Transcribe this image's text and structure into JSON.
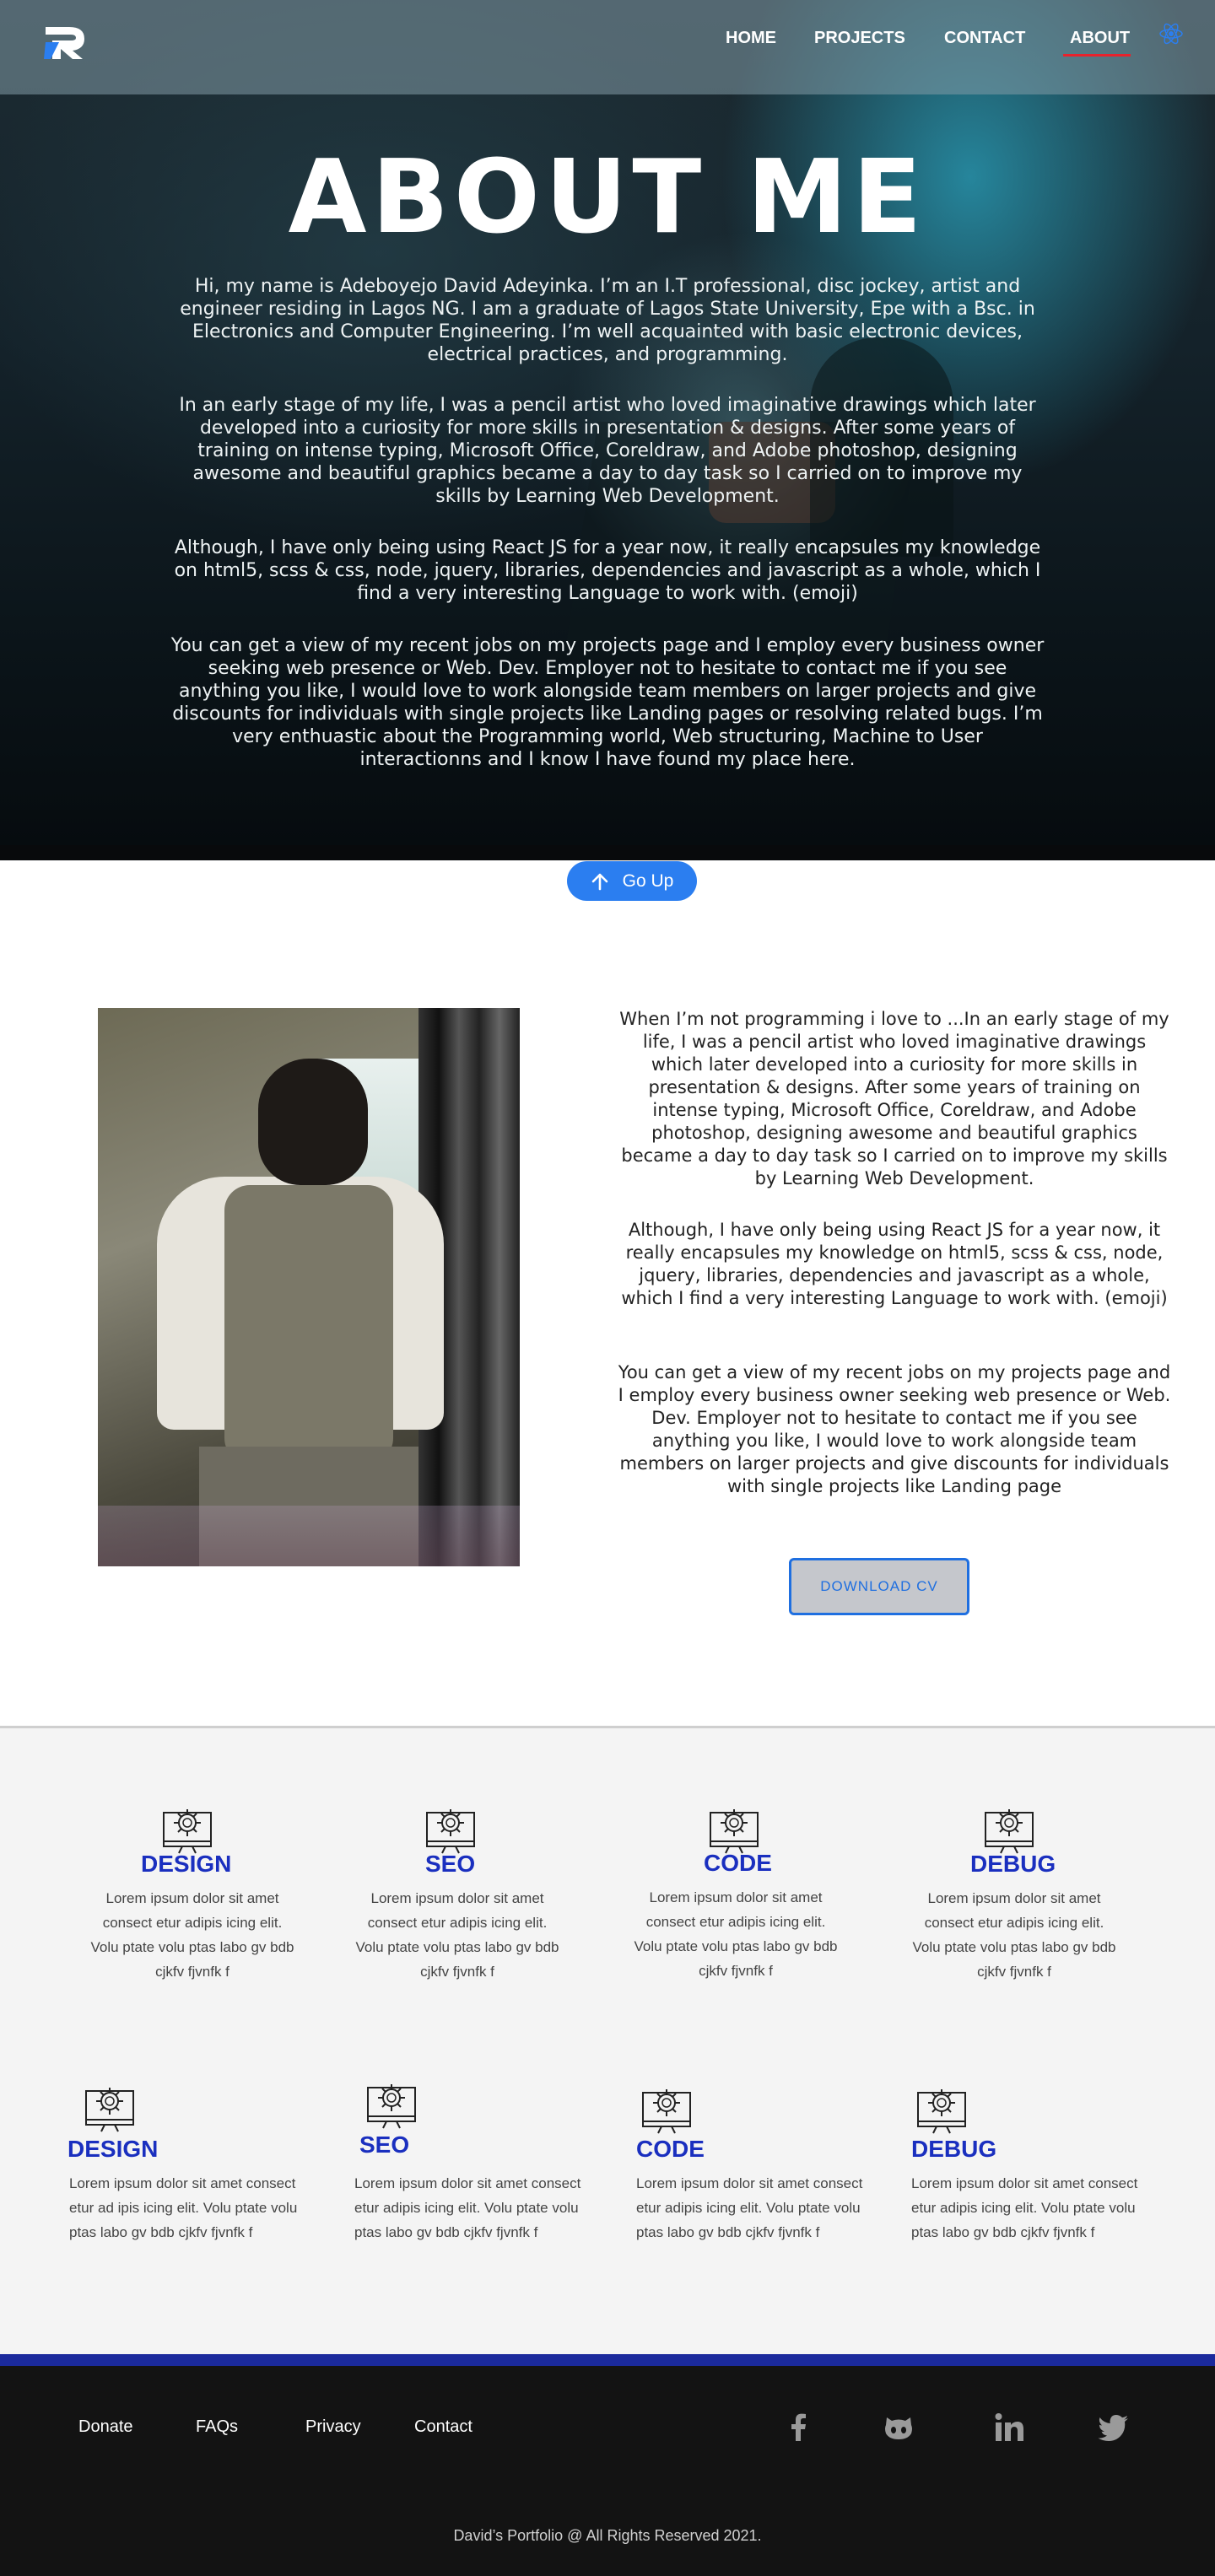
{
  "nav": {
    "items": [
      {
        "label": "HOME"
      },
      {
        "label": "PROJECTS"
      },
      {
        "label": "CONTACT"
      },
      {
        "label": "ABOUT"
      }
    ],
    "active": "ABOUT",
    "accent": "#e8222c"
  },
  "hero": {
    "title": "ABOUT ME",
    "paragraphs": [
      "Hi, my name is Adeboyejo David Adeyinka. I’m an I.T professional, disc jockey, artist and engineer residing in Lagos NG. I am a graduate of Lagos State University, Epe with a Bsc. in Electronics and Computer Engineering. I’m well acquainted with basic electronic devices, electrical practices,  and programming.",
      "In an early stage of my life, I was a pencil artist who loved imaginative drawings which later developed into a curiosity for more skills in presentation & designs. After some years of training on intense typing, Microsoft Office, Coreldraw, and Adobe photoshop, designing awesome and beautiful graphics became a day to day task so I carried on to improve my skills by Learning Web Development.",
      "Although, I have only being using React JS for a year now, it really encapsules my knowledge on html5, scss & css, node, jquery, libraries, dependencies and javascript as a whole, which I find a very interesting Language to work with. (emoji)",
      "You can get a view of my recent jobs on my projects page and I employ every business owner seeking web presence or Web. Dev. Employer not to hesitate to contact me if you see anything you like, I would love to work alongside team members on larger projects and give discounts for individuals with single projects like Landing pages or resolving related bugs. I’m very enthuastic about the Programming world, Web structuring, Machine to User interactionns and I know I have found my place here."
    ]
  },
  "goup": {
    "label": "Go Up",
    "color": "#2b7ef0"
  },
  "about": {
    "paragraphs": [
      "When I’m not programming i love to ...In an early stage of my life, I was a pencil artist who loved imaginative drawings which later developed into a curiosity for more skills in presentation & designs. After some years of training on intense typing, Microsoft Office, Coreldraw, and Adobe photoshop, designing awesome and beautiful graphics became a day to day task so I carried on to improve my skills by Learning Web Development.",
      "Although, I have only being using React JS for a year now, it really encapsules my knowledge on html5, scss & css, node, jquery, libraries, dependencies and javascript as a whole, which I find a very interesting Language to work with. (emoji)",
      "You can get a view of my recent jobs on my projects page and I employ every business owner seeking web presence or Web. Dev. Employer not to hesitate to contact me if you see anything you like, I would love to work alongside team members on larger projects and give discounts for individuals with single projects like Landing page"
    ],
    "cv_label": "DOWNLOAD  CV"
  },
  "services": {
    "title_color": "#1a2fbf",
    "row1": [
      {
        "title": "DESIGN",
        "text": "Lorem ipsum dolor sit amet consect etur adipis icing elit. Volu ptate volu ptas labo gv bdb cjkfv  fjvnfk f"
      },
      {
        "title": "SEO",
        "text": "Lorem ipsum dolor sit amet consect etur adipis icing elit. Volu ptate volu ptas labo gv bdb cjkfv  fjvnfk f"
      },
      {
        "title": "CODE",
        "text": "Lorem ipsum dolor sit amet consect etur adipis icing elit. Volu ptate volu ptas labo gv bdb cjkfv  fjvnfk f"
      },
      {
        "title": "DEBUG",
        "text": "Lorem ipsum dolor sit amet consect etur adipis icing elit. Volu ptate volu ptas labo gv bdb cjkfv  fjvnfk f"
      }
    ],
    "row2": [
      {
        "title": "DESIGN",
        "text": "Lorem ipsum dolor sit amet consect etur ad ipis icing elit. Volu ptate volu ptas labo gv bdb cjkfv  fjvnfk f"
      },
      {
        "title": "SEO",
        "text": "Lorem ipsum dolor sit amet consect etur adipis icing elit. Volu ptate volu ptas labo gv bdb cjkfv  fjvnfk f"
      },
      {
        "title": "CODE",
        "text": "Lorem ipsum dolor sit amet consect etur adipis icing elit. Volu ptate volu ptas labo gv bdb cjkfv  fjvnfk f"
      },
      {
        "title": "DEBUG",
        "text": "Lorem ipsum dolor sit amet consect etur adipis icing elit. Volu ptate volu ptas labo gv bdb cjkfv  fjvnfk f"
      }
    ]
  },
  "footer": {
    "links": [
      {
        "label": "Donate"
      },
      {
        "label": "FAQs"
      },
      {
        "label": "Privacy"
      },
      {
        "label": "Contact"
      }
    ],
    "social_icons": [
      "facebook-icon",
      "github-icon",
      "linkedin-icon",
      "twitter-icon"
    ],
    "copyright": "David’s Portfolio @ All Rights Reserved 2021.",
    "accent": "#1b2a9c"
  }
}
